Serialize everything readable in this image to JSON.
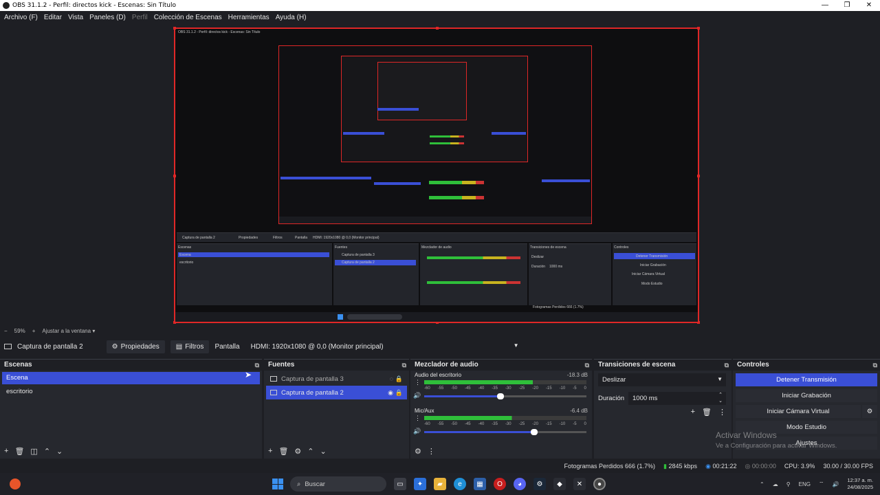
{
  "window": {
    "title": "OBS 31.1.2 - Perfil: directos kick - Escenas: Sin Título",
    "controls": [
      "—",
      "❐",
      "✕"
    ]
  },
  "menu": [
    "Archivo (F)",
    "Editar",
    "Vista",
    "Paneles (D)",
    "Perfil",
    "Colección de Escenas",
    "Herramientas",
    "Ayuda (H)"
  ],
  "zoom": {
    "minus": "−",
    "value": "59%",
    "plus": "+",
    "fit_label": "Ajustar a la ventana"
  },
  "source_bar": {
    "source_name": "Captura de pantalla 2",
    "properties_label": "Propiedades",
    "filters_label": "Filtros",
    "display_label": "Pantalla",
    "display_value": "HDMI: 1920x1080 @ 0,0 (Monitor principal)"
  },
  "scenes": {
    "title": "Escenas",
    "items": [
      "Escena",
      "escritorio"
    ],
    "selected": 0
  },
  "sources": {
    "title": "Fuentes",
    "items": [
      {
        "label": "Captura de pantalla 3",
        "visible": false
      },
      {
        "label": "Captura de pantalla 2",
        "visible": true
      }
    ]
  },
  "mixer": {
    "title": "Mezclador de audio",
    "ticks": [
      "-60",
      "-55",
      "-50",
      "-45",
      "-40",
      "-35",
      "-30",
      "-25",
      "-20",
      "-15",
      "-10",
      "-5",
      "0"
    ],
    "channels": [
      {
        "name": "Audio del escritorio",
        "db": "-18.3 dB",
        "level": 0.67,
        "volume": 0.47
      },
      {
        "name": "Mic/Aux",
        "db": "-6.4 dB",
        "level": 0.54,
        "volume": 0.68
      }
    ]
  },
  "transitions": {
    "title": "Transiciones de escena",
    "type": "Deslizar",
    "duration_label": "Duración",
    "duration_value": "1000 ms"
  },
  "controls": {
    "title": "Controles",
    "buttons": [
      "Detener Transmisión",
      "Iniciar Grabación",
      "Iniciar Cámara Virtual",
      "Modo Estudio",
      "Ajustes"
    ]
  },
  "watermark": {
    "line1": "Activar Windows",
    "line2": "Ve a Configuración para activar Windows."
  },
  "status": {
    "dropped": "Fotogramas Perdidos 666 (1.7%)",
    "bitrate": "2845 kbps",
    "stream_time": "00:21:22",
    "rec_time": "00:00:00",
    "cpu": "CPU: 3.9%",
    "fps": "30.00 / 30.00 FPS"
  },
  "taskbar": {
    "search_placeholder": "Buscar",
    "tray_lang": "ENG",
    "time": "12:37 a. m.",
    "date": "24/08/2025"
  },
  "colors": {
    "accent": "#3a4fd6",
    "selection_border": "#e02727",
    "meter_green": "#2fbf3a",
    "meter_yellow": "#c8b31f",
    "meter_red": "#cc3333"
  }
}
